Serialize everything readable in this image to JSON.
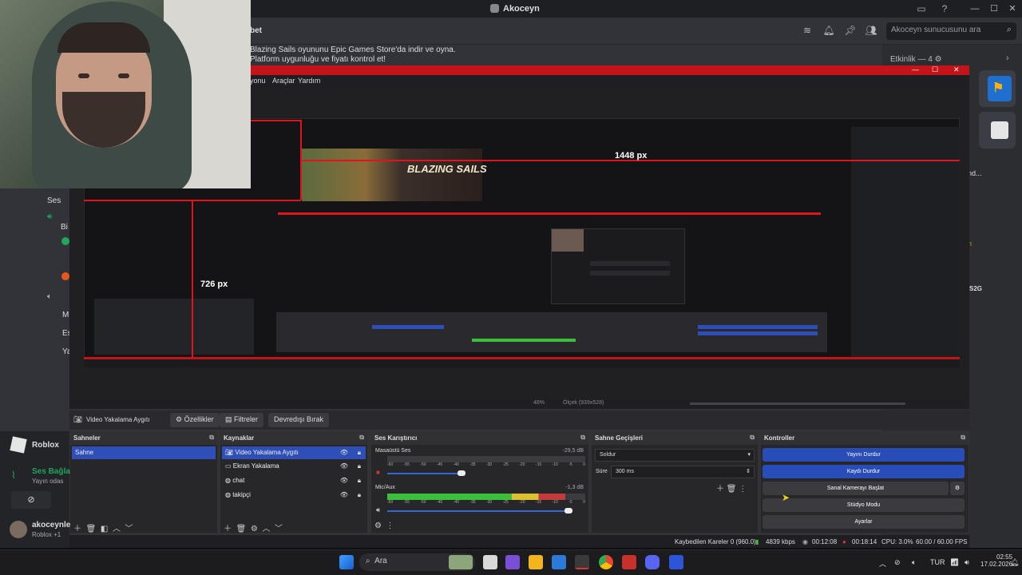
{
  "window": {
    "title": "Akoceyn",
    "controls": [
      "—",
      "☐",
      "✕"
    ]
  },
  "discord": {
    "search_placeholder": "Akoceyn sunucusunu ara",
    "channel_title": "bet",
    "message": "Blazing Sails oyununu Epic Games Store'da indir ve oyna. Platform uygunluğu ve fiyatı kontrol et!",
    "activity_label": "Etkinlik — 4",
    "side_text": [
      "nd...",
      "n",
      "S2G"
    ],
    "voice_label": "Ses Bağlantısı",
    "left_items": [
      "Ses",
      "Bi",
      "M",
      "Es",
      "Ya"
    ],
    "roblox_label": "Roblox",
    "voice_connected": "Ses Bağla",
    "voice_sub": "Yayın odas",
    "user_name": "akoceynle",
    "user_status": "Roblox +1"
  },
  "obs": {
    "window_controls": [
      "—",
      "☐",
      "✕"
    ],
    "menu": [
      "yonu",
      "Araçlar",
      "Yardım"
    ],
    "preview_label_width": "1448 px",
    "preview_label_height": "726 px",
    "game_title": "BLAZING SAILS",
    "zoom": "48%",
    "scaler": "Ölçek (939x528)",
    "source_toolbar": {
      "source_name": "Video Yakalama Aygıtı",
      "properties": "Özellikler",
      "filters": "Filtreler",
      "deactivate": "Devredışı Bırak"
    },
    "scenes": {
      "header": "Sahneler",
      "items": [
        "Sahne"
      ]
    },
    "sources": {
      "header": "Kaynaklar",
      "items": [
        "Video Yakalama Aygıtı",
        "Ekran Yakalama",
        "chat",
        "takipçi"
      ]
    },
    "mixer": {
      "header": "Ses Karıştırıcı",
      "channels": [
        {
          "name": "Masaüstü Ses",
          "db": "-29,5 dB",
          "level": 0.0
        },
        {
          "name": "Mic/Aux",
          "db": "-1,3 dB",
          "level": 0.9
        }
      ],
      "scale": [
        "-60",
        "-55",
        "-50",
        "-45",
        "-40",
        "-35",
        "-30",
        "-25",
        "-20",
        "-15",
        "-10",
        "-5",
        "0"
      ]
    },
    "transitions": {
      "header": "Sahne Geçişleri",
      "selected": "Soldur",
      "duration_label": "Süre",
      "duration": "300 ms"
    },
    "controls": {
      "header": "Kontroller",
      "stop_stream": "Yayını Durdur",
      "stop_recording": "Kaydı Durdur",
      "virtual_cam": "Sanal Kamerayı Başlat",
      "studio_mode": "Stüdyo Modu",
      "settings": "Ayarlar"
    },
    "status": {
      "dropped": "Kaybedilen Kareler 0 (960.0)",
      "bitrate": "4839 kbps",
      "stream_time": "00:12:08",
      "rec_time": "00:18:14",
      "cpu": "CPU: 3.0%",
      "fps": "60.00 / 60.00 FPS"
    }
  },
  "taskbar": {
    "search": "Ara",
    "lang": "TUR",
    "time": "02:55",
    "date": "17.02.2026"
  },
  "colors": {
    "accent_blue": "#284cb8",
    "obs_red": "#c4141a",
    "discord_bg": "#313338"
  }
}
